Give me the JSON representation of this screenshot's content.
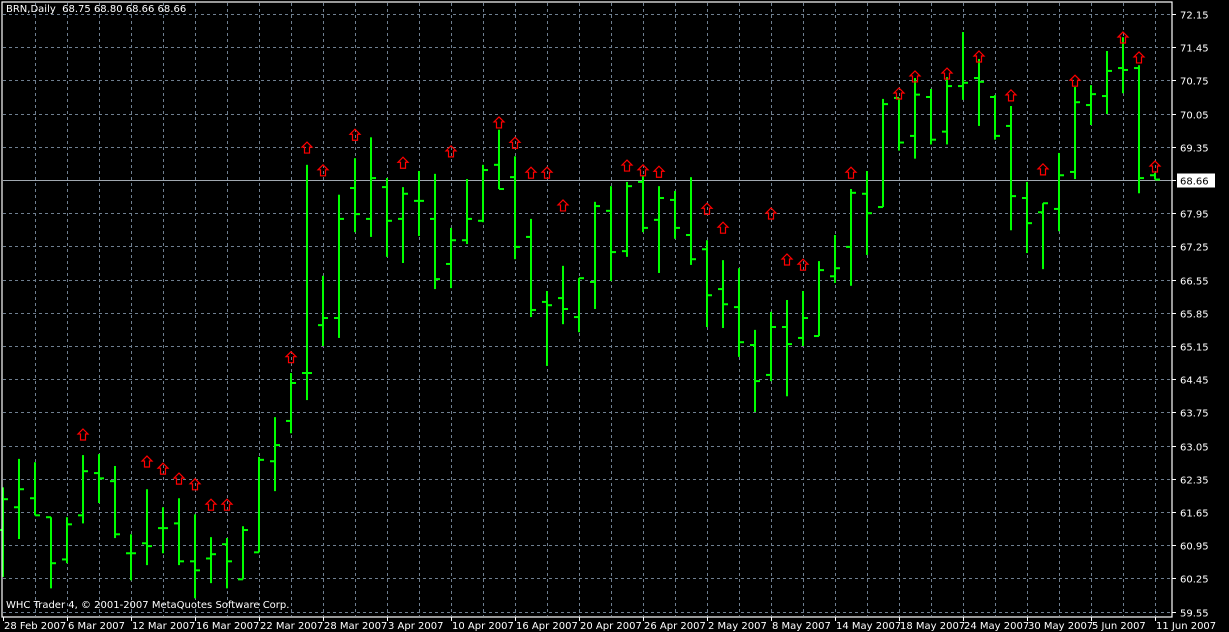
{
  "header": {
    "symbol": "BRN,Daily",
    "ohlc": "68.75 68.80 68.66 68.66"
  },
  "footer": {
    "copyright": "WHC Trader 4, © 2001-2007 MetaQuotes Software Corp."
  },
  "colors": {
    "background": "#000000",
    "bar": "#00ff00",
    "grid": "#6f7f90",
    "arrow": "#ff0000",
    "price_line": "#a0a8b0"
  },
  "chart_data": {
    "type": "ohlc",
    "title": "BRN,Daily",
    "ylim": [
      59.55,
      72.15
    ],
    "y_ticks": [
      "72.15",
      "71.45",
      "70.75",
      "70.05",
      "69.35",
      "68.65",
      "67.95",
      "67.25",
      "66.55",
      "65.85",
      "65.15",
      "64.45",
      "63.75",
      "63.05",
      "62.35",
      "61.65",
      "60.95",
      "60.25",
      "59.55"
    ],
    "current_price": "68.66",
    "x_labels": [
      {
        "bar": 0,
        "label": "28 Feb 2007"
      },
      {
        "bar": 4,
        "label": "6 Mar 2007"
      },
      {
        "bar": 8,
        "label": "12 Mar 2007"
      },
      {
        "bar": 12,
        "label": "16 Mar 2007"
      },
      {
        "bar": 16,
        "label": "22 Mar 2007"
      },
      {
        "bar": 20,
        "label": "28 Mar 2007"
      },
      {
        "bar": 24,
        "label": "3 Apr 2007"
      },
      {
        "bar": 28,
        "label": "10 Apr 2007"
      },
      {
        "bar": 32,
        "label": "16 Apr 2007"
      },
      {
        "bar": 36,
        "label": "20 Apr 2007"
      },
      {
        "bar": 40,
        "label": "26 Apr 2007"
      },
      {
        "bar": 44,
        "label": "2 May 2007"
      },
      {
        "bar": 48,
        "label": "8 May 2007"
      },
      {
        "bar": 52,
        "label": "14 May 2007"
      },
      {
        "bar": 56,
        "label": "18 May 2007"
      },
      {
        "bar": 60,
        "label": "24 May 2007"
      },
      {
        "bar": 64,
        "label": "30 May 2007"
      },
      {
        "bar": 68,
        "label": "5 Jun 2007"
      },
      {
        "bar": 72,
        "label": "11 Jun 2007"
      }
    ],
    "bars": [
      [
        61.27,
        62.17,
        60.28,
        61.92
      ],
      [
        61.75,
        62.77,
        61.08,
        62.13
      ],
      [
        61.94,
        62.7,
        61.58,
        61.58
      ],
      [
        61.54,
        61.54,
        60.04,
        60.57
      ],
      [
        60.65,
        61.54,
        60.57,
        61.39
      ],
      [
        61.58,
        62.85,
        61.41,
        62.51
      ],
      [
        62.47,
        62.87,
        61.84,
        62.36
      ],
      [
        62.3,
        62.62,
        61.1,
        61.18
      ],
      [
        60.78,
        61.18,
        60.21,
        60.78
      ],
      [
        60.99,
        62.13,
        60.53,
        60.93
      ],
      [
        61.31,
        61.75,
        60.78,
        61.31
      ],
      [
        61.41,
        61.94,
        60.53,
        60.61
      ],
      [
        60.61,
        61.6,
        59.83,
        60.42
      ],
      [
        60.67,
        61.12,
        60.15,
        60.76
      ],
      [
        60.97,
        61.1,
        60.04,
        60.61
      ],
      [
        60.23,
        61.35,
        60.23,
        61.27
      ],
      [
        60.8,
        62.81,
        60.8,
        62.75
      ],
      [
        62.72,
        63.65,
        62.09,
        63.06
      ],
      [
        63.57,
        64.58,
        63.31,
        64.37
      ],
      [
        64.58,
        68.97,
        64.01,
        64.58
      ],
      [
        65.59,
        66.63,
        65.15,
        65.74
      ],
      [
        65.74,
        68.34,
        65.32,
        67.83
      ],
      [
        68.48,
        69.11,
        67.55,
        67.93
      ],
      [
        67.83,
        69.55,
        67.45,
        68.69
      ],
      [
        68.5,
        68.69,
        67.03,
        67.79
      ],
      [
        67.83,
        68.5,
        66.9,
        68.36
      ],
      [
        68.21,
        68.84,
        67.47,
        68.21
      ],
      [
        67.83,
        68.78,
        66.35,
        66.56
      ],
      [
        66.88,
        67.64,
        66.37,
        67.38
      ],
      [
        67.38,
        68.67,
        67.3,
        67.83
      ],
      [
        67.79,
        68.97,
        67.76,
        68.86
      ],
      [
        68.97,
        69.71,
        68.46,
        68.46
      ],
      [
        68.71,
        69.15,
        66.98,
        67.24
      ],
      [
        67.45,
        67.83,
        65.76,
        65.91
      ],
      [
        66.08,
        66.31,
        64.73,
        66.01
      ],
      [
        66.16,
        66.84,
        65.61,
        65.93
      ],
      [
        65.76,
        66.58,
        65.44,
        66.58
      ],
      [
        66.5,
        68.19,
        65.93,
        68.1
      ],
      [
        68.0,
        68.52,
        66.52,
        67.13
      ],
      [
        67.15,
        68.61,
        67.03,
        68.52
      ],
      [
        68.61,
        68.73,
        67.55,
        67.64
      ],
      [
        67.81,
        68.52,
        66.69,
        68.27
      ],
      [
        68.23,
        68.42,
        67.41,
        67.64
      ],
      [
        67.49,
        68.71,
        66.86,
        66.98
      ],
      [
        67.19,
        67.38,
        65.55,
        66.22
      ],
      [
        66.35,
        66.96,
        65.53,
        66.03
      ],
      [
        65.97,
        66.79,
        64.92,
        65.23
      ],
      [
        65.17,
        65.49,
        63.76,
        64.41
      ],
      [
        64.54,
        65.87,
        64.41,
        65.55
      ],
      [
        65.55,
        66.12,
        64.09,
        65.19
      ],
      [
        65.32,
        66.31,
        65.15,
        65.74
      ],
      [
        65.36,
        66.94,
        65.36,
        66.75
      ],
      [
        66.62,
        67.49,
        66.48,
        66.79
      ],
      [
        67.24,
        68.46,
        66.42,
        68.38
      ],
      [
        68.36,
        68.84,
        67.07,
        67.95
      ],
      [
        68.08,
        70.36,
        68.08,
        70.25
      ],
      [
        70.38,
        70.38,
        69.27,
        69.44
      ],
      [
        69.58,
        70.8,
        69.1,
        70.45
      ],
      [
        70.4,
        70.57,
        69.4,
        69.5
      ],
      [
        69.67,
        70.82,
        69.4,
        70.63
      ],
      [
        70.63,
        71.77,
        70.34,
        70.7
      ],
      [
        70.8,
        71.2,
        69.79,
        70.72
      ],
      [
        70.4,
        70.44,
        69.5,
        69.58
      ],
      [
        69.79,
        70.21,
        67.59,
        68.31
      ],
      [
        68.27,
        68.61,
        67.11,
        67.74
      ],
      [
        67.97,
        68.16,
        66.77,
        68.16
      ],
      [
        68.04,
        69.22,
        67.57,
        68.75
      ],
      [
        68.82,
        70.61,
        68.67,
        70.29
      ],
      [
        70.23,
        70.65,
        69.81,
        70.46
      ],
      [
        70.42,
        71.37,
        70.04,
        70.95
      ],
      [
        71.01,
        71.66,
        70.48,
        70.97
      ],
      [
        71.01,
        71.07,
        68.37,
        68.69
      ],
      [
        68.75,
        68.8,
        68.66,
        68.66
      ]
    ],
    "bar_fields": [
      "open",
      "high",
      "low",
      "close"
    ],
    "up_arrows": [
      [
        5,
        63.4
      ],
      [
        9,
        62.83
      ],
      [
        10,
        62.68
      ],
      [
        11,
        62.47
      ],
      [
        12,
        62.35
      ],
      [
        13,
        61.92
      ],
      [
        14,
        61.92
      ],
      [
        18,
        65.03
      ],
      [
        19,
        69.45
      ],
      [
        20,
        68.97
      ],
      [
        22,
        69.72
      ],
      [
        25,
        69.13
      ],
      [
        28,
        69.37
      ],
      [
        31,
        69.98
      ],
      [
        32,
        69.55
      ],
      [
        33,
        68.92
      ],
      [
        34,
        68.92
      ],
      [
        35,
        68.23
      ],
      [
        39,
        69.07
      ],
      [
        40,
        68.97
      ],
      [
        41,
        68.94
      ],
      [
        44,
        68.16
      ],
      [
        45,
        67.76
      ],
      [
        48,
        68.06
      ],
      [
        49,
        67.09
      ],
      [
        50,
        66.98
      ],
      [
        53,
        68.92
      ],
      [
        56,
        70.59
      ],
      [
        57,
        70.95
      ],
      [
        59,
        71.01
      ],
      [
        61,
        71.37
      ],
      [
        63,
        70.55
      ],
      [
        65,
        68.99
      ],
      [
        67,
        70.86
      ],
      [
        70,
        71.77
      ],
      [
        71,
        71.35
      ],
      [
        72,
        69.05
      ]
    ]
  }
}
